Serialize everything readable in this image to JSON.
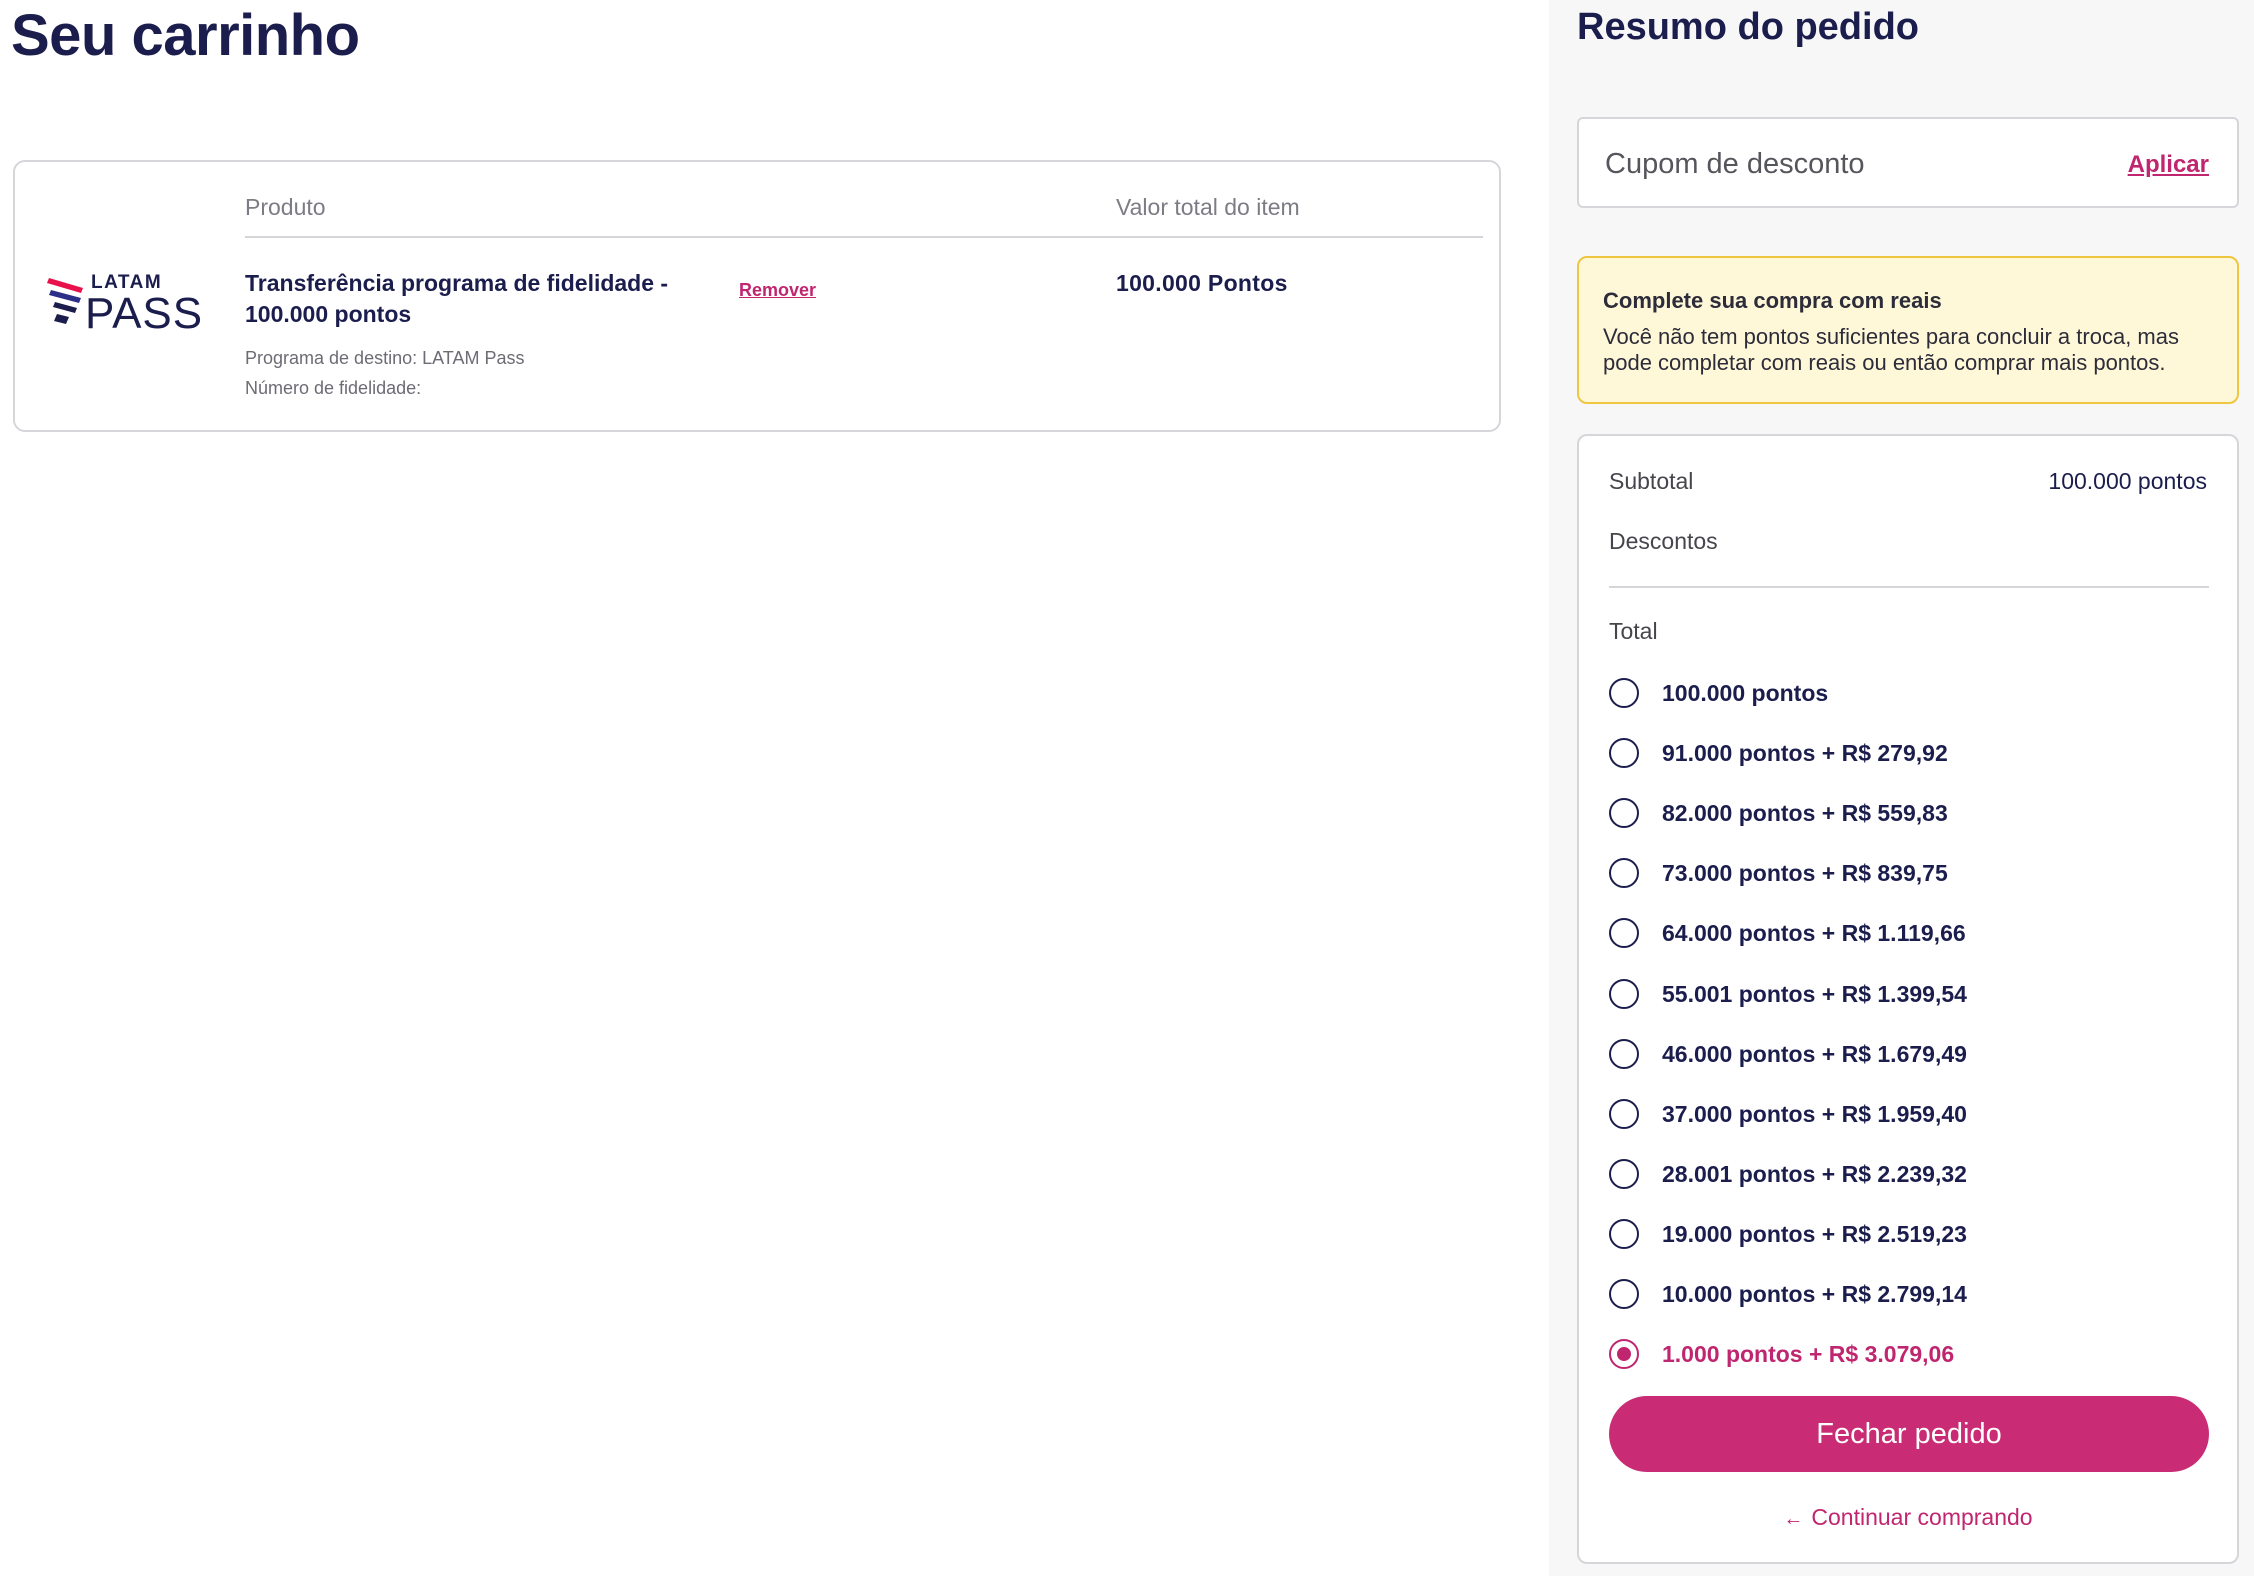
{
  "cart": {
    "title": "Seu carrinho",
    "columns": {
      "product": "Produto",
      "total": "Valor total do item"
    },
    "item": {
      "name": "Transferência programa de fidelidade - 100.000 pontos",
      "remove_label": "Remover",
      "total": "100.000 Pontos",
      "destination": "Programa de destino: LATAM Pass",
      "fidelity_number": "Número de fidelidade:",
      "logo": {
        "top_text": "LATAM",
        "bottom_text": "PASS",
        "color": "#1b1d4d",
        "accent_colors": [
          "#e8114b",
          "#2b2f8a"
        ]
      }
    }
  },
  "summary": {
    "title": "Resumo do pedido",
    "coupon": {
      "placeholder": "Cupom de desconto",
      "apply_label": "Aplicar"
    },
    "alert": {
      "title": "Complete sua compra com reais",
      "text": "Você não tem pontos suficientes para concluir a troca, mas pode completar com reais ou então comprar mais pontos."
    },
    "subtotal_label": "Subtotal",
    "subtotal_value": "100.000 pontos",
    "discounts_label": "Descontos",
    "total_label": "Total",
    "options": [
      {
        "label": "100.000 pontos",
        "selected": false
      },
      {
        "label": "91.000 pontos + R$ 279,92",
        "selected": false
      },
      {
        "label": "82.000 pontos + R$ 559,83",
        "selected": false
      },
      {
        "label": "73.000 pontos + R$ 839,75",
        "selected": false
      },
      {
        "label": "64.000 pontos + R$ 1.119,66",
        "selected": false
      },
      {
        "label": "55.001 pontos + R$ 1.399,54",
        "selected": false
      },
      {
        "label": "46.000 pontos + R$ 1.679,49",
        "selected": false
      },
      {
        "label": "37.000 pontos + R$ 1.959,40",
        "selected": false
      },
      {
        "label": "28.001 pontos + R$ 2.239,32",
        "selected": false
      },
      {
        "label": "19.000 pontos + R$ 2.519,23",
        "selected": false
      },
      {
        "label": "10.000 pontos + R$ 2.799,14",
        "selected": false
      },
      {
        "label": "1.000 pontos + R$ 3.079,06",
        "selected": true
      }
    ],
    "checkout_label": "Fechar pedido",
    "continue_label": "Continuar comprando",
    "continue_icon": "arrow-left-icon"
  },
  "colors": {
    "navy": "#1b1d4d",
    "accent": "#c92c75",
    "link": "#c0266f",
    "alert_bg": "#fff8d8",
    "alert_border": "#efc63f",
    "sidebar_bg": "#f7f7f8"
  }
}
